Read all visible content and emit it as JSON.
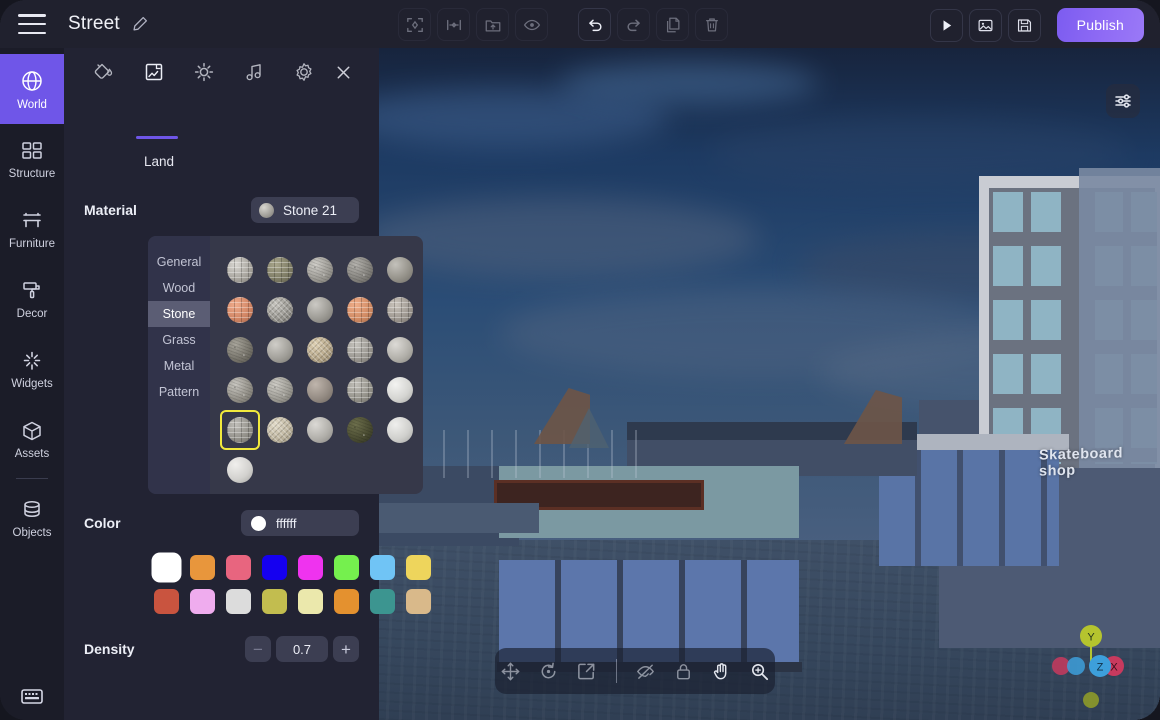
{
  "app": {
    "project_title": "Street",
    "menu_icon": "hamburger-icon",
    "edit_icon": "pencil-icon"
  },
  "toolbar": {
    "center_buttons": [
      {
        "name": "focus-frame-button",
        "icon": "focus-frame-icon",
        "active": false
      },
      {
        "name": "align-button",
        "icon": "align-horizontal-icon",
        "active": false
      },
      {
        "name": "import-folder-button",
        "icon": "folder-upload-icon",
        "active": false
      },
      {
        "name": "visibility-button",
        "icon": "eye-icon",
        "active": false
      },
      {
        "name": "undo-button",
        "icon": "undo-icon",
        "active": true
      },
      {
        "name": "redo-button",
        "icon": "redo-icon",
        "active": false
      },
      {
        "name": "duplicate-button",
        "icon": "copy-icon",
        "active": false
      },
      {
        "name": "delete-button",
        "icon": "trash-icon",
        "active": false
      }
    ],
    "right_buttons": [
      {
        "name": "play-button",
        "icon": "play-icon"
      },
      {
        "name": "screenshot-button",
        "icon": "image-icon"
      },
      {
        "name": "save-button",
        "icon": "floppy-save-icon"
      }
    ],
    "publish_label": "Publish",
    "publish_color": "#7c5cf0"
  },
  "sidebar": {
    "items": [
      {
        "label": "World",
        "icon": "globe-icon",
        "active": true
      },
      {
        "label": "Structure",
        "icon": "structure-icon",
        "active": false
      },
      {
        "label": "Furniture",
        "icon": "furniture-icon",
        "active": false
      },
      {
        "label": "Decor",
        "icon": "paint-roller-icon",
        "active": false
      },
      {
        "label": "Widgets",
        "icon": "sparkle-icon",
        "active": false
      },
      {
        "label": "Assets",
        "icon": "cube-icon",
        "active": false
      },
      {
        "label": "Objects",
        "icon": "database-icon",
        "active": false
      }
    ],
    "active_color": "#6f56e8",
    "keyboard_shortcut_icon": "keyboard-icon"
  },
  "panel": {
    "tabs": [
      {
        "name": "paint-bucket-tab",
        "icon": "paint-bucket-icon",
        "active": false
      },
      {
        "name": "land-tab",
        "icon": "land-icon",
        "active": true
      },
      {
        "name": "lighting-tab",
        "icon": "sun-icon",
        "active": false
      },
      {
        "name": "audio-tab",
        "icon": "music-note-icon",
        "active": false
      },
      {
        "name": "settings-tab",
        "icon": "gear-icon",
        "active": false
      }
    ],
    "close_icon": "close-icon",
    "active_tab_label": "Land",
    "material": {
      "section_label": "Material",
      "selected_name": "Stone 21",
      "categories": [
        {
          "label": "General",
          "active": false
        },
        {
          "label": "Wood",
          "active": false
        },
        {
          "label": "Stone",
          "active": true
        },
        {
          "label": "Grass",
          "active": false
        },
        {
          "label": "Metal",
          "active": false
        },
        {
          "label": "Pattern",
          "active": false
        }
      ],
      "selected_index": 20,
      "selection_outline_color": "#f1e93c",
      "swatches": [
        {
          "c1": "#d9d7d2",
          "c2": "#a7a49d",
          "c3": "#7d7b76",
          "pat": "brick"
        },
        {
          "c1": "#a9a68c",
          "c2": "#7e7c65",
          "c3": "#5d5b49",
          "pat": "brick"
        },
        {
          "c1": "#cfcdc8",
          "c2": "#9d9b95",
          "c3": "#76746f",
          "pat": "speck"
        },
        {
          "c1": "#b4b2ad",
          "c2": "#85837e",
          "c3": "#615f5b",
          "pat": "speck"
        },
        {
          "c1": "#c3c1bb",
          "c2": "#949189",
          "c3": "#6e6c66",
          "pat": "plain"
        },
        {
          "c1": "#f0ac8c",
          "c2": "#d08463",
          "c3": "#a3654a",
          "pat": "brick"
        },
        {
          "c1": "#c6c4be",
          "c2": "#97958f",
          "c3": "#6f6d68",
          "pat": "herring"
        },
        {
          "c1": "#cbc9c4",
          "c2": "#9b9993",
          "c3": "#73716c",
          "pat": "plain"
        },
        {
          "c1": "#f0ae8a",
          "c2": "#d08a63",
          "c3": "#a36a48",
          "pat": "brick"
        },
        {
          "c1": "#cbc5bd",
          "c2": "#9c968f",
          "c3": "#74706a",
          "pat": "brick"
        },
        {
          "c1": "#a8a59b",
          "c2": "#78756c",
          "c3": "#55534c",
          "pat": "speck"
        },
        {
          "c1": "#cfcdc8",
          "c2": "#a09e98",
          "c3": "#78766f",
          "pat": "plain"
        },
        {
          "c1": "#ded0b3",
          "c2": "#b3a487",
          "c3": "#877b63",
          "pat": "herring"
        },
        {
          "c1": "#c6c4be",
          "c2": "#98958f",
          "c3": "#716f69",
          "pat": "brick"
        },
        {
          "c1": "#dcdad6",
          "c2": "#b1afa9",
          "c3": "#87857f",
          "pat": "plain"
        },
        {
          "c1": "#c8c6c0",
          "c2": "#949189",
          "c3": "#6c6a64",
          "pat": "speck"
        },
        {
          "c1": "#cdcbc5",
          "c2": "#9e9c95",
          "c3": "#76746e",
          "pat": "speck"
        },
        {
          "c1": "#bfb5ac",
          "c2": "#938a82",
          "c3": "#6d655e",
          "pat": "plain"
        },
        {
          "c1": "#c2c0ba",
          "c2": "#939189",
          "c3": "#6c6a64",
          "pat": "brick"
        },
        {
          "c1": "#f3f3f1",
          "c2": "#d4d4d1",
          "c3": "#a8a8a5",
          "pat": "plain"
        },
        {
          "c1": "#c0beb9",
          "c2": "#929089",
          "c3": "#6b6964",
          "pat": "brick"
        },
        {
          "c1": "#e2dbc8",
          "c2": "#bdb49e",
          "c3": "#918a76",
          "pat": "herring"
        },
        {
          "c1": "#dbd9d5",
          "c2": "#b0aea9",
          "c3": "#868480",
          "pat": "plain"
        },
        {
          "c1": "#6d6f4c",
          "c2": "#4a4c32",
          "c3": "#2e3020",
          "pat": "speck"
        },
        {
          "c1": "#efefed",
          "c2": "#cfcfcc",
          "c3": "#a4a4a1",
          "pat": "plain"
        },
        {
          "c1": "#f0efed",
          "c2": "#d2d1ce",
          "c3": "#a6a5a2",
          "pat": "plain"
        }
      ]
    },
    "color": {
      "section_label": "Color",
      "value": "ffffff",
      "selected_index": 0,
      "palette": [
        "#ffffff",
        "#e8963c",
        "#e8657f",
        "#1500f0",
        "#ef33ef",
        "#75f04e",
        "#70c4f5",
        "#eed55c",
        "#c9543f",
        "#efacee",
        "#dcdcdc",
        "#c2bd4f",
        "#ebe8ac",
        "#e4912f",
        "#3c9590",
        "#d9b98a"
      ]
    },
    "density": {
      "section_label": "Density",
      "value": "0.7",
      "decrement_label": "−",
      "increment_label": "+"
    }
  },
  "viewport": {
    "settings_icon": "sliders-icon",
    "scene_sign_text": "Skateboard shop",
    "tools": [
      {
        "name": "move-tool",
        "icon": "move-arrows-icon",
        "active": false
      },
      {
        "name": "rotate-tool",
        "icon": "rotate-icon",
        "active": false
      },
      {
        "name": "scale-tool",
        "icon": "scale-expand-icon",
        "active": false
      },
      {
        "name": "hide-tool",
        "icon": "eye-off-icon",
        "active": false
      },
      {
        "name": "lock-tool",
        "icon": "lock-icon",
        "active": false
      },
      {
        "name": "pan-tool",
        "icon": "hand-icon",
        "active": true
      },
      {
        "name": "zoom-tool",
        "icon": "magnifier-icon",
        "active": true
      }
    ],
    "gizmo": {
      "axes": [
        {
          "label": "Y",
          "color": "#b5c42e"
        },
        {
          "label": "Z",
          "color": "#3d9fdb"
        },
        {
          "label": "X",
          "color": "#c83a5e"
        }
      ]
    }
  }
}
